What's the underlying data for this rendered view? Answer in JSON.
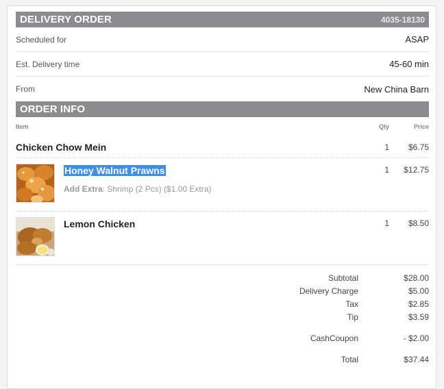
{
  "delivery": {
    "title": "DELIVERY ORDER",
    "order_number": "4035-18130",
    "rows": [
      {
        "label": "Scheduled for",
        "value": "ASAP"
      },
      {
        "label": "Est. Delivery time",
        "value": "45-60 min"
      },
      {
        "label": "From",
        "value": "New China Barn"
      }
    ]
  },
  "order_info": {
    "title": "ORDER INFO",
    "columns": {
      "item": "Item",
      "qty": "Qty",
      "price": "Price"
    },
    "items": [
      {
        "name": "Chicken Chow Mein",
        "qty": "1",
        "price": "$6.75"
      },
      {
        "name": "Honey Walnut Prawns",
        "qty": "1",
        "price": "$12.75",
        "extra_label": "Add Extra",
        "extra_value": ": Shrimp (2 Pcs) ($1.00 Extra)",
        "image": "fried-prawns-photo"
      },
      {
        "name": "Lemon Chicken",
        "qty": "1",
        "price": "$8.50",
        "image": "lemon-chicken-photo"
      }
    ]
  },
  "totals": {
    "subtotal": {
      "label": "Subtotal",
      "value": "$28.00"
    },
    "delivery_charge": {
      "label": "Delivery Charge",
      "value": "$5.00"
    },
    "tax": {
      "label": "Tax",
      "value": "$2.85"
    },
    "tip": {
      "label": "Tip",
      "value": "$3.59"
    },
    "coupon": {
      "label": "CashCoupon",
      "value": "- $2.00"
    },
    "total": {
      "label": "Total",
      "value": "$37.44"
    }
  },
  "colors": {
    "section_bar": "#8a8c8e",
    "selection": "#3e8ee8"
  }
}
